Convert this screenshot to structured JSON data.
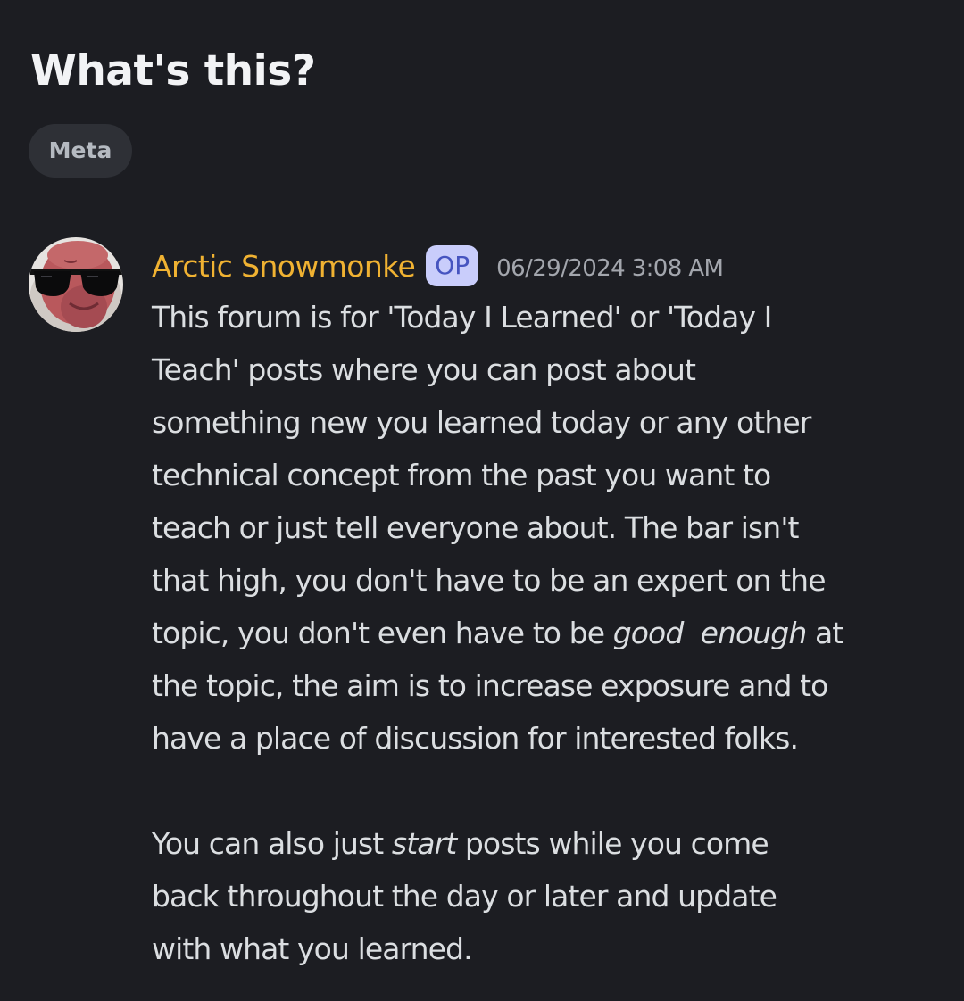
{
  "thread": {
    "title": "What's this?",
    "tag": "Meta"
  },
  "post": {
    "author": "Arctic Snowmonke",
    "badge": "OP",
    "timestamp": "06/29/2024 3:08 AM",
    "author_color": "#f0b232",
    "paragraph1": {
      "line1": "This forum is for 'Today I Learned' or 'Today I",
      "line2": "Teach' posts where you can post about",
      "line3": "something new you learned today or any other",
      "line4": "technical concept from the past you want to",
      "line5": "teach or just tell everyone about. The bar isn't",
      "line6": "that high, you don't have to be an expert on the",
      "line7_before": "topic, you don't even have to be ",
      "line7_em1": "good",
      "line7_space": "  ",
      "line7_em2": "enough",
      "line7_after": " at",
      "line8": "the topic, the aim is to increase exposure and to",
      "line9": "have a place of discussion for interested folks."
    },
    "paragraph2": {
      "line1_before": "You can also just ",
      "line1_em": "start",
      "line1_after": " posts while you come",
      "line2": "back throughout the day or later and update",
      "line3": "with what you learned."
    }
  },
  "icons": {
    "avatar": "avatar-monkey-sunglasses"
  }
}
